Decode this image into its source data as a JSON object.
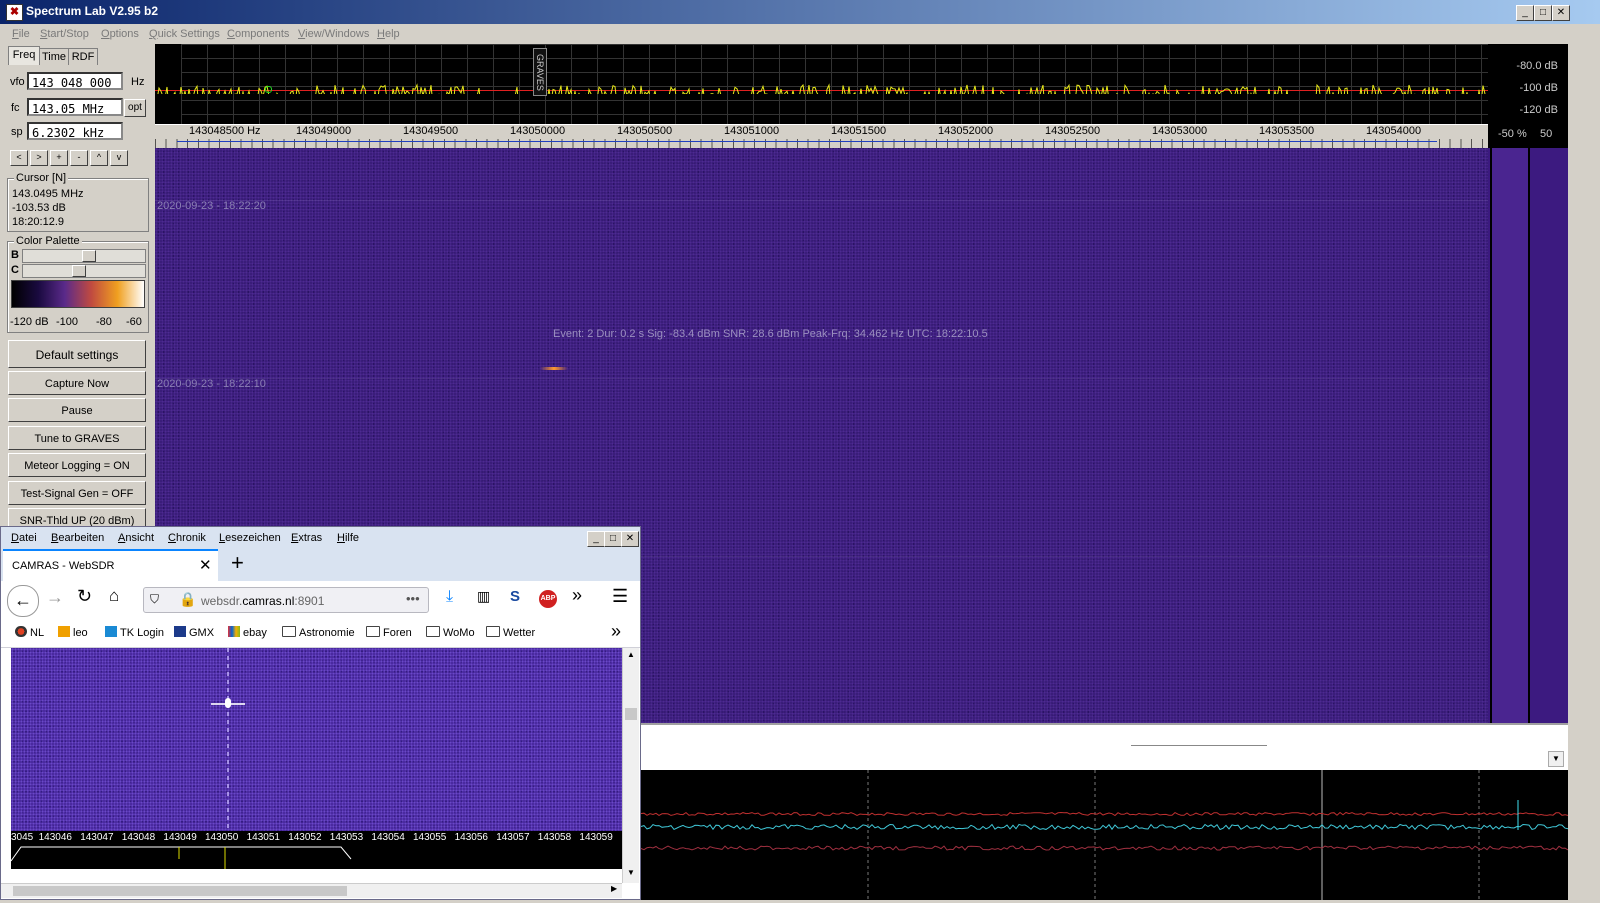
{
  "app": {
    "title": "Spectrum Lab V2.95 b2"
  },
  "menu": [
    "File",
    "Start/Stop",
    "Options",
    "Quick Settings",
    "Components",
    "View/Windows",
    "Help"
  ],
  "left_panel": {
    "tabs": [
      "Freq",
      "Time",
      "RDF"
    ],
    "vfo_label": "vfo",
    "vfo_value": "143 048 000",
    "vfo_unit": "Hz",
    "fc_label": "fc",
    "fc_value": "143.05 MHz",
    "opt_label": "opt",
    "sp_label": "sp",
    "sp_value": "6.2302 kHz",
    "nav_buttons": [
      "<",
      ">",
      "+",
      "-",
      "^",
      "v"
    ],
    "cursor_group": "Cursor [N]",
    "cursor_freq": "143.0495 MHz",
    "cursor_level": "-103.53 dB",
    "cursor_time": "18:20:12.9",
    "palette_group": "Color Palette",
    "b_label": "B",
    "c_label": "C",
    "palette_ticks": [
      "-120 dB",
      "-100",
      "-80",
      "-60"
    ],
    "b_level": 0.55,
    "c_level": 0.45,
    "buttons": [
      "Default settings",
      "Capture Now",
      "Pause",
      "Tune to GRAVES",
      "Meteor Logging = ON",
      "Test-Signal Gen = OFF",
      "SNR-Thld UP (20 dBm)"
    ]
  },
  "spectrum": {
    "db_labels": [
      "-80.0 dB",
      "-100 dB",
      "-120 dB"
    ],
    "marker_label": "GRAVES",
    "freq_labels": [
      "143048500 Hz",
      "143049000",
      "143049500",
      "143050000",
      "143050500",
      "143051000",
      "143051500",
      "143052000",
      "143052500",
      "143053000",
      "143053500",
      "143054000"
    ],
    "pct_label": "-50 %",
    "pct_value": "50"
  },
  "waterfall": {
    "timestamps": [
      "2020-09-23 - 18:22:20",
      "2020-09-23 - 18:22:10"
    ],
    "event_text": "Event: 2   Dur: 0.2 s   Sig: -83.4 dBm   SNR: 28.6 dBm   Peak-Frq: 34.462 Hz   UTC: 18:22:10.5"
  },
  "firefox": {
    "menu": [
      "Datei",
      "Bearbeiten",
      "Ansicht",
      "Chronik",
      "Lesezeichen",
      "Extras",
      "Hilfe"
    ],
    "tab_title": "CAMRAS - WebSDR",
    "url_domain": "websdr.camras.nl",
    "url_host_prefix": "websdr.",
    "url_host_main": "camras.nl",
    "url_port": ":8901",
    "bookmarks": [
      "NL",
      "leo",
      "TK Login",
      "GMX",
      "ebay",
      "Astronomie",
      "Foren",
      "WoMo",
      "Wetter"
    ],
    "sdr_axis": [
      "3045",
      "143046",
      "143047",
      "143048",
      "143049",
      "143050",
      "143051",
      "143052",
      "143053",
      "143054",
      "143055",
      "143056",
      "143057",
      "143058",
      "143059"
    ]
  },
  "colors": {
    "waterfall": "#3a1d7a",
    "spectrum_trace": "#e8e81a",
    "threshold": "#e02020",
    "accent": "#0a84ff"
  }
}
